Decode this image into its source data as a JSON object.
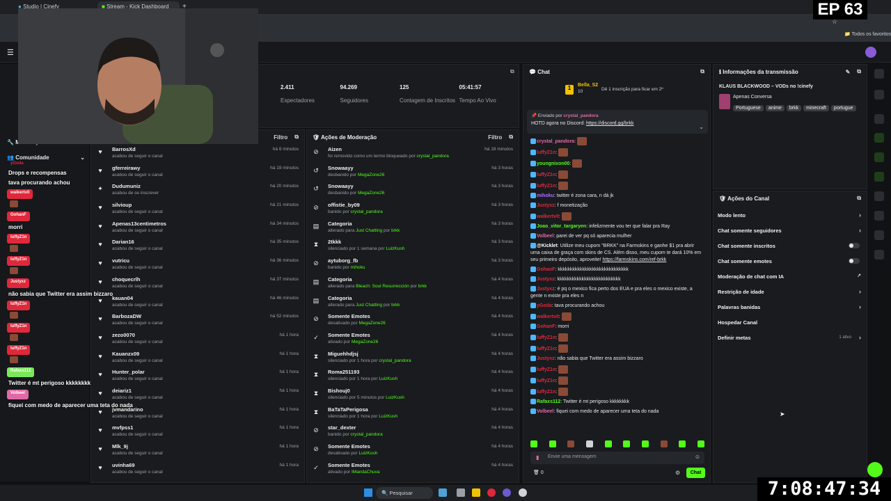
{
  "browser": {
    "tabs": [
      {
        "label": "Studio | Cinefy"
      },
      {
        "label": "Stream - Kick Dashboard"
      }
    ],
    "bookmarks_label": "Todos os favoritos"
  },
  "overlay": {
    "episode": "EP 63",
    "timer": "7:08:47:34"
  },
  "stream_stats": [
    {
      "value": "2.411",
      "label": "Espectadores"
    },
    {
      "value": "94.269",
      "label": "Seguidores"
    },
    {
      "value": "125",
      "label": "Contagem de Inscritos"
    },
    {
      "value": "05:41:57",
      "label": "Tempo Ao Vivo"
    }
  ],
  "left_nav": {
    "moderation": "Moderação",
    "community": "Comunidade"
  },
  "activity": {
    "filter_label": "Filtro",
    "rows": [
      {
        "icon": "heart",
        "name": "BarrosXd",
        "sub": "acabou de seguir o canal",
        "time": "há 6 minutos"
      },
      {
        "icon": "heart",
        "name": "gferreirawy",
        "sub": "acabou de seguir o canal",
        "time": "há 19 minutos"
      },
      {
        "icon": "star",
        "name": "Dudumuniz",
        "sub": "acabou de se inscrever",
        "time": "há 20 minutos"
      },
      {
        "icon": "heart",
        "name": "silvioup",
        "sub": "acabou de seguir o canal",
        "time": "há 21 minutos"
      },
      {
        "icon": "heart",
        "name": "Apenas13centimetros",
        "sub": "acabou de seguir o canal",
        "time": "há 34 minutos"
      },
      {
        "icon": "heart",
        "name": "Darian16",
        "sub": "acabou de seguir o canal",
        "time": "há 35 minutos"
      },
      {
        "icon": "heart",
        "name": "vutricu",
        "sub": "acabou de seguir o canal",
        "time": "há 36 minutos"
      },
      {
        "icon": "heart",
        "name": "choquecrlh",
        "sub": "acabou de seguir o canal",
        "time": "há 37 minutos"
      },
      {
        "icon": "heart",
        "name": "kauan04",
        "sub": "acabou de seguir o canal",
        "time": "há 46 minutos"
      },
      {
        "icon": "heart",
        "name": "BarbozaDW",
        "sub": "acabou de seguir o canal",
        "time": "há 52 minutos"
      },
      {
        "icon": "heart",
        "name": "zezo0070",
        "sub": "acabou de seguir o canal",
        "time": "há 1 hora"
      },
      {
        "icon": "heart",
        "name": "Kauanzx09",
        "sub": "acabou de seguir o canal",
        "time": "há 1 hora"
      },
      {
        "icon": "heart",
        "name": "Hunter_polar",
        "sub": "acabou de seguir o canal",
        "time": "há 1 hora"
      },
      {
        "icon": "heart",
        "name": "deiariz1",
        "sub": "acabou de seguir o canal",
        "time": "há 1 hora"
      },
      {
        "icon": "heart",
        "name": "jvmandarino",
        "sub": "acabou de seguir o canal",
        "time": "há 1 hora"
      },
      {
        "icon": "heart",
        "name": "mvfpss1",
        "sub": "acabou de seguir o canal",
        "time": "há 1 hora"
      },
      {
        "icon": "heart",
        "name": "Mlk_9j",
        "sub": "acabou de seguir o canal",
        "time": "há 1 hora"
      },
      {
        "icon": "heart",
        "name": "uvinha69",
        "sub": "acabou de seguir o canal",
        "time": "há 1 hora"
      }
    ]
  },
  "moderation": {
    "title": "Ações de Moderação",
    "filter_label": "Filtro",
    "rows": [
      {
        "icon": "x",
        "name": "Aizen",
        "pre": "foi removido como um termo bloqueado por ",
        "who": "crystal_pandora",
        "time": "há 18 minutos"
      },
      {
        "icon": "undo",
        "name": "Snowaayy",
        "pre": "desbanido por ",
        "who": "MegaZone26",
        "time": "há 3 horas"
      },
      {
        "icon": "undo",
        "name": "Snowaayy",
        "pre": "desbanido por ",
        "who": "MegaZone26",
        "time": "há 3 horas"
      },
      {
        "icon": "ban",
        "name": "offistie_by09",
        "pre": "banido por ",
        "who": "crystal_pandora",
        "time": "há 3 horas"
      },
      {
        "icon": "cat",
        "name": "Categoria",
        "pre": "alterado para ",
        "who": "Just Chatting",
        "post": " por ",
        "who2": "brkk",
        "time": "há 3 horas"
      },
      {
        "icon": "hour",
        "name": "2tkkk",
        "pre": "silenciado por 1 semana por ",
        "who": "LuizKush",
        "time": "há 3 horas"
      },
      {
        "icon": "ban",
        "name": "aytuborg_fb",
        "pre": "banido por ",
        "who": "mihoku",
        "time": "há 3 horas"
      },
      {
        "icon": "cat",
        "name": "Categoria",
        "pre": "alterado para ",
        "who": "Bleach: Soul Resurrección",
        "post": " por ",
        "who2": "brkk",
        "time": "há 4 horas"
      },
      {
        "icon": "cat",
        "name": "Categoria",
        "pre": "alterado para ",
        "who": "Just Chatting",
        "post": " por ",
        "who2": "brkk",
        "time": "há 4 horas"
      },
      {
        "icon": "x",
        "name": "Somente Emotes",
        "pre": "desativado por ",
        "who": "MegaZone26",
        "time": "há 4 horas"
      },
      {
        "icon": "check",
        "name": "Somente Emotes",
        "pre": "ativado por ",
        "who": "MegaZone26",
        "time": "há 4 horas"
      },
      {
        "icon": "hour",
        "name": "Miguehhdjsj",
        "pre": "silenciado por 1 hora por ",
        "who": "crystal_pandora",
        "time": "há 4 horas"
      },
      {
        "icon": "hour",
        "name": "Roma251193",
        "pre": "silenciado por 1 hora por ",
        "who": "LuizKush",
        "time": "há 4 horas"
      },
      {
        "icon": "hour",
        "name": "Bishouj0",
        "pre": "silenciado por 5 minutos por ",
        "who": "LuizKush",
        "time": "há 4 horas"
      },
      {
        "icon": "hour",
        "name": "BaTaTaPerigosa",
        "pre": "silenciado por 1 hora por ",
        "who": "LuizKush",
        "time": "há 4 horas"
      },
      {
        "icon": "ban",
        "name": "star_dexter",
        "pre": "banido por ",
        "who": "crystal_pandora",
        "time": "há 4 horas"
      },
      {
        "icon": "x",
        "name": "Somente Emotes",
        "pre": "desativado por ",
        "who": "LuizKush",
        "time": "há 4 horas"
      },
      {
        "icon": "check",
        "name": "Somente Emotes",
        "pre": "ativado por ",
        "who": "IMandaChuva",
        "time": "há 4 horas"
      }
    ]
  },
  "chat": {
    "title": "Chat",
    "top_user": "Bella_S2",
    "top_user_count": "10",
    "top_note": "Dê 1 inscrição para ficar em 2º",
    "pinned_by_prefix": "Enviado por",
    "pinned_by": "crystal_pandora",
    "pinned_text": "HOTD agora no Discord: ",
    "pinned_link": "https://discord.gg/brkk",
    "messages": [
      {
        "user": "crystal_pandora",
        "color": "#e06aa6",
        "text": ":",
        "emote": true
      },
      {
        "user": "luffyZ1n",
        "color": "#e0283b",
        "text": ":",
        "emote": true
      },
      {
        "user": "youngnixon00",
        "color": "#53fc18",
        "text": ":",
        "emote": true
      },
      {
        "user": "luffyZ1n",
        "color": "#e0283b",
        "text": ":",
        "emote": true
      },
      {
        "user": "luffyZ1n",
        "color": "#e0283b",
        "text": ":",
        "emote": true
      },
      {
        "user": "mihoku",
        "color": "#a970ff",
        "text": ": twitter é zona cara, n dá jk"
      },
      {
        "user": "Justyxz",
        "color": "#e0283b",
        "text": ": f monetização"
      },
      {
        "user": "walkertv0",
        "color": "#e0283b",
        "text": ":",
        "emote": true
      },
      {
        "user": "Joao_vitor_targaryen",
        "color": "#53fc18",
        "text": ": infelizmente vou ter que falar pra Ray"
      },
      {
        "user": "Volbeel",
        "color": "#e06aa6",
        "text": ": parei de ver pq só aparecia mulher"
      },
      {
        "user": "@Kicklet",
        "color": "#ffffff",
        "text": ": Utilize meu cupom \"BRKK\" na Farmskins e ganhe $1 pra abrir uma caixa de graça com skins de CS. Além disso, meu cupom te dará 10% em seu primeiro depósito, aproveite! ",
        "link": "https://farmskins.com/ref-brkk"
      },
      {
        "user": "GohanF",
        "color": "#e0283b",
        "text": ": kkkkkkkkkkkkkkkkkkkkkkkkkkkkk"
      },
      {
        "user": "Justyxz",
        "color": "#e0283b",
        "text": ": kkkkkkkkkkkkkkkkkkkkkkkkkk"
      },
      {
        "user": "Justyxz",
        "color": "#e0283b",
        "text": ": é pq o mexico fica perto dos EUA e pra eles o mexico existe, a gente n existe pra eles n"
      },
      {
        "user": "yGoda",
        "color": "#e0283b",
        "text": ": tava procurando achou"
      },
      {
        "user": "walkertv0",
        "color": "#e0283b",
        "text": ":",
        "emote": true
      },
      {
        "user": "GohanF",
        "color": "#e0283b",
        "text": ": morri"
      },
      {
        "user": "luffyZ1n",
        "color": "#e0283b",
        "text": ":",
        "emote": true
      },
      {
        "user": "luffyZ1n",
        "color": "#e0283b",
        "text": ":",
        "emote": true
      },
      {
        "user": "Justyxz",
        "color": "#e0283b",
        "text": ": não sabia que Twitter era assim bizzaro"
      },
      {
        "user": "luffyZ1n",
        "color": "#e0283b",
        "text": ":",
        "emote": true
      },
      {
        "user": "luffyZ1n",
        "color": "#e0283b",
        "text": ":",
        "emote": true
      },
      {
        "user": "luffyZ1n",
        "color": "#e0283b",
        "text": ":",
        "emote": true
      },
      {
        "user": "Rafaxs112",
        "color": "#53fc18",
        "text": ": Twitter é mt perigoso kkkkkkkk"
      },
      {
        "user": "Volbeel",
        "color": "#e06aa6",
        "text": ": fiquei com medo de aparecer uma teta do nada"
      }
    ],
    "input_placeholder": "Envie uma mensagem",
    "viewer_count": "0",
    "send_label": "Chat"
  },
  "stream_info": {
    "title": "Informações da transmissão",
    "stream_title": "KLAUS BLACKWOOD – VODs no !cinefy",
    "category": "Apenas Conversa",
    "tags": [
      "Portuguese",
      "anime",
      "brkk",
      "minecraft",
      "portugue"
    ]
  },
  "channel_actions": {
    "title": "Ações do Canal",
    "items": [
      {
        "label": "Modo lento",
        "kind": "chevron"
      },
      {
        "label": "Chat somente seguidores",
        "kind": "chevron"
      },
      {
        "label": "Chat somente inscritos",
        "kind": "toggle"
      },
      {
        "label": "Chat somente emotes",
        "kind": "toggle"
      },
      {
        "label": "Moderação de chat com IA",
        "kind": "external"
      },
      {
        "label": "Restrição de idade",
        "kind": "chevron"
      },
      {
        "label": "Palavras banidas",
        "kind": "chevron"
      },
      {
        "label": "Hospedar Canal",
        "kind": "none"
      },
      {
        "label": "Definir metas",
        "kind": "chevron",
        "badge": "1 ativo"
      }
    ]
  },
  "overlay_chat": [
    {
      "type": "name",
      "text": "yGoda"
    },
    {
      "type": "text",
      "text": "Drops e recompensas"
    },
    {
      "type": "text",
      "text": "tava procurando achou"
    },
    {
      "type": "name",
      "text": "walkertv0"
    },
    {
      "type": "name",
      "text": "GohanF"
    },
    {
      "type": "text",
      "text": "morri"
    },
    {
      "type": "name",
      "text": "luffyZ1n"
    },
    {
      "type": "name",
      "text": "luffyZ1n"
    },
    {
      "type": "name",
      "text": "Justyxz"
    },
    {
      "type": "text",
      "text": "não sabia que Twitter era assim bizzaro"
    },
    {
      "type": "name",
      "text": "luffyZ1n"
    },
    {
      "type": "name",
      "text": "luffyZ1n"
    },
    {
      "type": "name",
      "text": "luffyZ1n"
    },
    {
      "type": "name",
      "text": "Rafaxs112"
    },
    {
      "type": "text",
      "text": "Twitter é mt perigoso kkkkkkkk"
    },
    {
      "type": "name",
      "text": "Volbeel"
    },
    {
      "type": "text",
      "text": "fiquei com medo de aparecer uma teta do nada"
    }
  ],
  "taskbar": {
    "search_label": "Pesquisar"
  }
}
